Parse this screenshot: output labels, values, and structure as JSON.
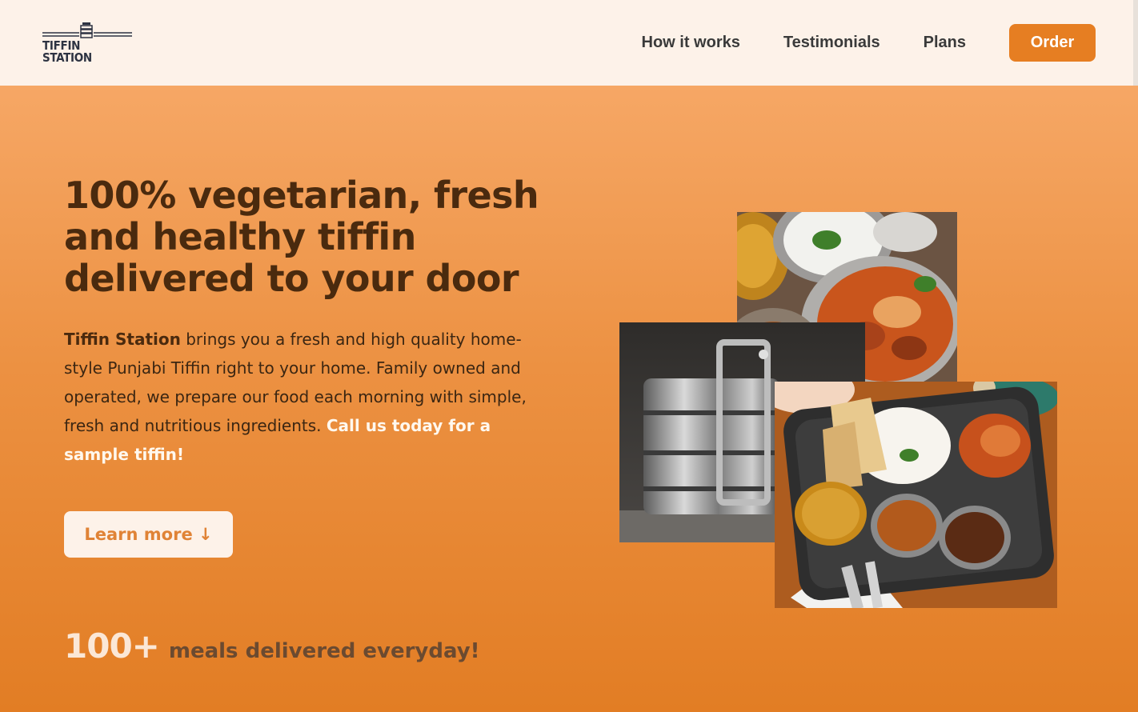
{
  "header": {
    "logo_text": "TIFFIN STATION",
    "nav": [
      {
        "label": "How it works"
      },
      {
        "label": "Testimonials"
      },
      {
        "label": "Plans"
      }
    ],
    "order_label": "Order"
  },
  "hero": {
    "title": "100% vegetarian, fresh and healthy tiffin delivered to your door",
    "brand": "Tiffin Station",
    "description": " brings you a fresh and high quality home-style Punjabi Tiffin right to your home. Family owned and operated, we prepare our food each morning with simple, fresh and nutritious ingredients. ",
    "cta": "Call us today for a sample tiffin!",
    "learn_more_label": "Learn more ↓",
    "stat_number": "100+",
    "stat_label": "meals delivered everyday!"
  },
  "colors": {
    "accent": "#e67e22",
    "header_bg": "#fdf2e9",
    "title_text": "#4a2a0e"
  },
  "images": [
    {
      "name": "curry-photo"
    },
    {
      "name": "tiffin-photo"
    },
    {
      "name": "thali-photo"
    }
  ]
}
